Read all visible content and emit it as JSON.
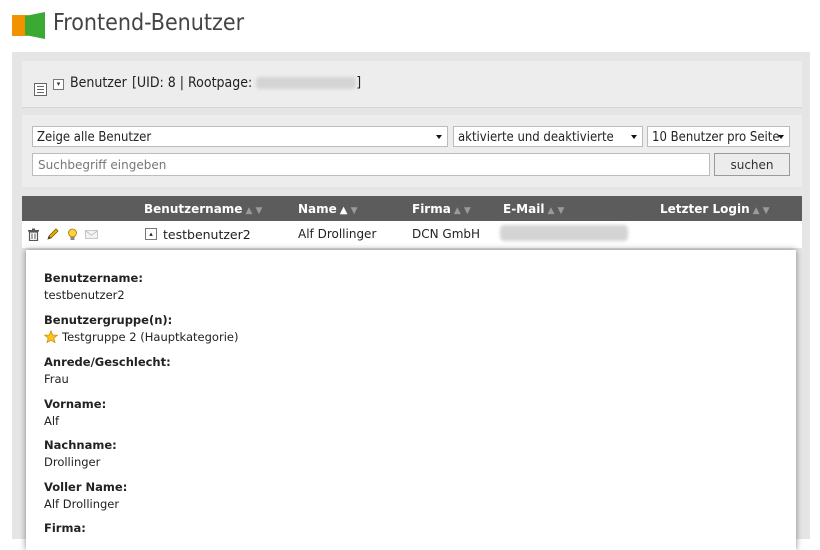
{
  "app": {
    "title": "Frontend-Benutzer"
  },
  "header": {
    "module_label": "Benutzer",
    "uid_text": "[UID: 8 | Rootpage:",
    "close_bracket": "]"
  },
  "filters": {
    "user_filter": "Zeige alle Benutzer",
    "status_filter": "aktivierte und deaktivierte",
    "per_page": "10 Benutzer pro Seite",
    "search_placeholder": "Suchbegriff eingeben",
    "search_button": "suchen"
  },
  "table": {
    "columns": [
      {
        "label": "Benutzername",
        "sort": "none"
      },
      {
        "label": "Name",
        "sort": "asc"
      },
      {
        "label": "Firma",
        "sort": "none"
      },
      {
        "label": "E-Mail",
        "sort": "none"
      },
      {
        "label": "Letzter Login",
        "sort": "none"
      }
    ],
    "rows": [
      {
        "username": "testbenutzer2",
        "name": "Alf Drollinger",
        "company": "DCN GmbH"
      }
    ]
  },
  "detail": {
    "fields": [
      {
        "label": "Benutzername:",
        "value": "testbenutzer2"
      },
      {
        "label": "Benutzergruppe(n):",
        "value": "Testgruppe 2 (Hauptkategorie)"
      },
      {
        "label": "Anrede/Geschlecht:",
        "value": "Frau"
      },
      {
        "label": "Vorname:",
        "value": "Alf"
      },
      {
        "label": "Nachname:",
        "value": "Drollinger"
      },
      {
        "label": "Voller Name:",
        "value": "Alf Drollinger"
      },
      {
        "label": "Firma:",
        "value": ""
      }
    ]
  },
  "colors": {
    "header_bg": "#5c5c5c",
    "logo_orange": "#f39200",
    "logo_green": "#3aaa35"
  }
}
